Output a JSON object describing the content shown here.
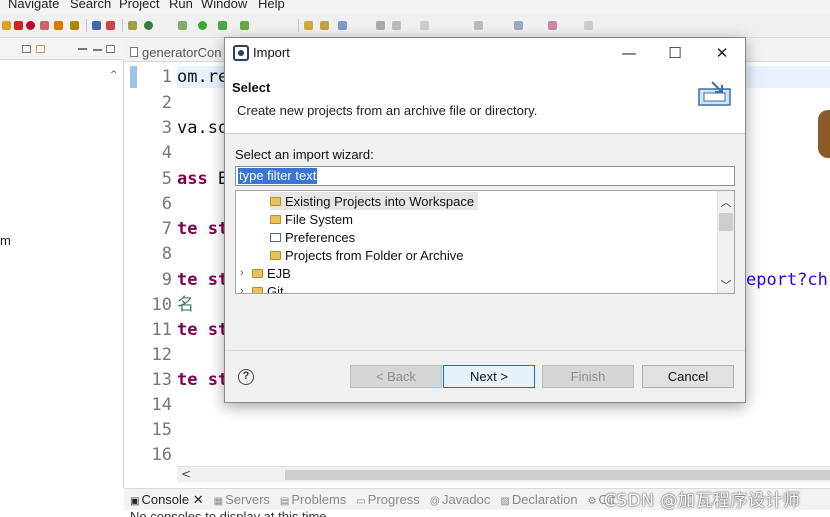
{
  "menubar": {
    "items": [
      "Navigate",
      "Search",
      "Project",
      "Run",
      "Window",
      "Help"
    ]
  },
  "editor": {
    "tab_label": "generatorCon",
    "line_numbers": [
      "1",
      "2",
      "3",
      "4",
      "5",
      "6",
      "7",
      "8",
      "9",
      "10",
      "11",
      "12",
      "13",
      "14",
      "15",
      "16"
    ],
    "lines": [
      {
        "num": "1",
        "text": "om.re",
        "style": "plain"
      },
      {
        "num": "3",
        "text": "va.sq",
        "style": "plain"
      },
      {
        "num": "5",
        "text": "ass B",
        "kw": "ass",
        "rest": " B"
      },
      {
        "num": "7",
        "text": "te st",
        "style": "kw"
      },
      {
        "num": "9",
        "text": "te st",
        "style": "kw"
      },
      {
        "num": "10",
        "text": "名",
        "style": "cm"
      },
      {
        "num": "11",
        "text": "te st",
        "style": "kw"
      },
      {
        "num": "13",
        "text": "te st",
        "style": "kw"
      }
    ],
    "right_fragment": "eport?ch"
  },
  "left_panel": {
    "fragment": "m"
  },
  "bottom": {
    "tabs": [
      {
        "label": "Console",
        "icon": "console-icon",
        "active": true
      },
      {
        "label": "Servers",
        "icon": "servers-icon"
      },
      {
        "label": "Problems",
        "icon": "problems-icon"
      },
      {
        "label": "Progress",
        "icon": "progress-icon"
      },
      {
        "label": "Javadoc",
        "icon": "javadoc-icon"
      },
      {
        "label": "Declaration",
        "icon": "declaration-icon"
      },
      {
        "label": "Git",
        "icon": "git-icon"
      }
    ],
    "message": "No consoles to display at this time.",
    "watermark": "CSDN @加瓦程序设计师"
  },
  "dialog": {
    "title": "Import",
    "header_title": "Select",
    "header_desc": "Create new projects from an archive file or directory.",
    "wizard_label": "Select an import wizard:",
    "filter_placeholder": "type filter text",
    "tree_items": [
      {
        "label": "Existing Projects into Workspace",
        "icon": "project-icon",
        "selected": true
      },
      {
        "label": "File System",
        "icon": "folder-icon"
      },
      {
        "label": "Preferences",
        "icon": "preferences-icon"
      },
      {
        "label": "Projects from Folder or Archive",
        "icon": "folder-icon"
      },
      {
        "label": "EJB",
        "icon": "folder-icon",
        "expandable": true
      },
      {
        "label": "Git",
        "icon": "folder-icon",
        "expandable": true
      }
    ],
    "buttons": {
      "back": "< Back",
      "next": "Next >",
      "finish": "Finish",
      "cancel": "Cancel"
    },
    "window_controls": {
      "minimize": "—",
      "maximize": "☐",
      "close": "✕"
    }
  }
}
